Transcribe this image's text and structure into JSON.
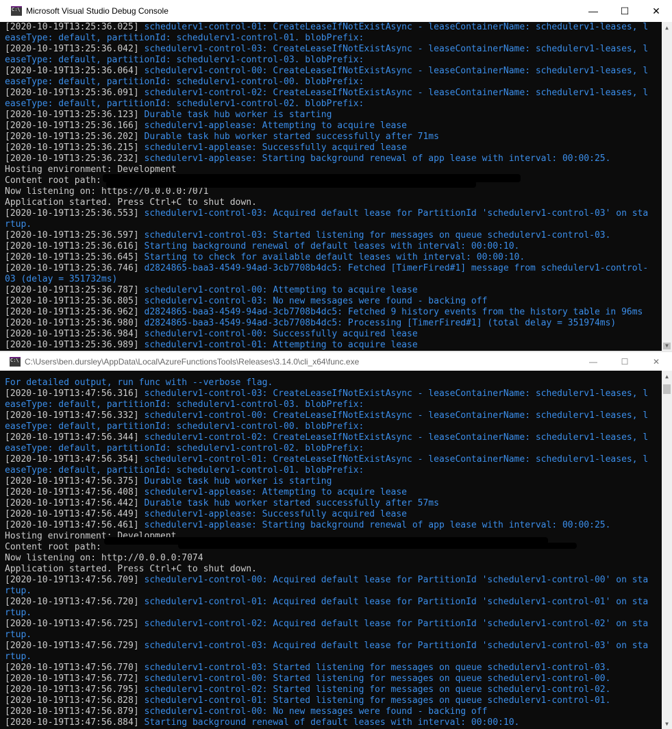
{
  "window1": {
    "title": "Microsoft Visual Studio Debug Console",
    "caption": {
      "minimize": "—",
      "maximize": "☐",
      "close": "✕"
    },
    "lines": [
      {
        "ts": "[2020-10-19T13:25:36.025]",
        "msg": " schedulerv1-control-01: CreateLeaseIfNotExistAsync - leaseContainerName: schedulerv1-leases, l"
      },
      {
        "ts": "",
        "msg": "easeType: default, partitionId: schedulerv1-control-01. blobPrefix:"
      },
      {
        "ts": "[2020-10-19T13:25:36.042]",
        "msg": " schedulerv1-control-03: CreateLeaseIfNotExistAsync - leaseContainerName: schedulerv1-leases, l"
      },
      {
        "ts": "",
        "msg": "easeType: default, partitionId: schedulerv1-control-03. blobPrefix:"
      },
      {
        "ts": "[2020-10-19T13:25:36.064]",
        "msg": " schedulerv1-control-00: CreateLeaseIfNotExistAsync - leaseContainerName: schedulerv1-leases, l"
      },
      {
        "ts": "",
        "msg": "easeType: default, partitionId: schedulerv1-control-00. blobPrefix:"
      },
      {
        "ts": "[2020-10-19T13:25:36.091]",
        "msg": " schedulerv1-control-02: CreateLeaseIfNotExistAsync - leaseContainerName: schedulerv1-leases, l"
      },
      {
        "ts": "",
        "msg": "easeType: default, partitionId: schedulerv1-control-02. blobPrefix:"
      },
      {
        "ts": "[2020-10-19T13:25:36.123]",
        "msg": " Durable task hub worker is starting"
      },
      {
        "ts": "[2020-10-19T13:25:36.166]",
        "msg": " schedulerv1-applease: Attempting to acquire lease"
      },
      {
        "ts": "[2020-10-19T13:25:36.202]",
        "msg": " Durable task hub worker started successfully after 71ms"
      },
      {
        "ts": "[2020-10-19T13:25:36.215]",
        "msg": " schedulerv1-applease: Successfully acquired lease"
      },
      {
        "ts": "[2020-10-19T13:25:36.232]",
        "msg": " schedulerv1-applease: Starting background renewal of app lease with interval: 00:00:25."
      },
      {
        "ts": "Hosting environment: Development",
        "msg": ""
      },
      {
        "ts": "Content root path:",
        "msg": ""
      },
      {
        "ts": "Now listening on: https://0.0.0.0:7071",
        "msg": ""
      },
      {
        "ts": "Application started. Press Ctrl+C to shut down.",
        "msg": ""
      },
      {
        "ts": "[2020-10-19T13:25:36.553]",
        "msg": " schedulerv1-control-03: Acquired default lease for PartitionId 'schedulerv1-control-03' on sta"
      },
      {
        "ts": "",
        "msg": "rtup."
      },
      {
        "ts": "[2020-10-19T13:25:36.597]",
        "msg": " schedulerv1-control-03: Started listening for messages on queue schedulerv1-control-03."
      },
      {
        "ts": "[2020-10-19T13:25:36.616]",
        "msg": " Starting background renewal of default leases with interval: 00:00:10."
      },
      {
        "ts": "[2020-10-19T13:25:36.645]",
        "msg": " Starting to check for available default leases with interval: 00:00:10."
      },
      {
        "ts": "[2020-10-19T13:25:36.746]",
        "msg": " d2824865-baa3-4549-94ad-3cb7708b4dc5: Fetched [TimerFired#1] message from schedulerv1-control-"
      },
      {
        "ts": "",
        "msg": "03 (delay = 351732ms)"
      },
      {
        "ts": "[2020-10-19T13:25:36.787]",
        "msg": " schedulerv1-control-00: Attempting to acquire lease"
      },
      {
        "ts": "[2020-10-19T13:25:36.805]",
        "msg": " schedulerv1-control-03: No new messages were found - backing off"
      },
      {
        "ts": "[2020-10-19T13:25:36.962]",
        "msg": " d2824865-baa3-4549-94ad-3cb7708b4dc5: Fetched 9 history events from the history table in 96ms"
      },
      {
        "ts": "[2020-10-19T13:25:36.980]",
        "msg": " d2824865-baa3-4549-94ad-3cb7708b4dc5: Processing [TimerFired#1] (total delay = 351974ms)"
      },
      {
        "ts": "[2020-10-19T13:25:36.984]",
        "msg": " schedulerv1-control-00: Successfully acquired lease"
      },
      {
        "ts": "[2020-10-19T13:25:36.989]",
        "msg": " schedulerv1-control-01: Attempting to acquire lease"
      }
    ]
  },
  "window2": {
    "title": "C:\\Users\\ben.dursley\\AppData\\Local\\AzureFunctionsTools\\Releases\\3.14.0\\cli_x64\\func.exe",
    "caption": {
      "minimize": "—",
      "maximize": "☐",
      "close": "✕"
    },
    "lines": [
      {
        "ts": "",
        "msg": "For detailed output, run func with --verbose flag."
      },
      {
        "ts": "[2020-10-19T13:47:56.316]",
        "msg": " schedulerv1-control-03: CreateLeaseIfNotExistAsync - leaseContainerName: schedulerv1-leases, l"
      },
      {
        "ts": "",
        "msg": "easeType: default, partitionId: schedulerv1-control-03. blobPrefix:"
      },
      {
        "ts": "[2020-10-19T13:47:56.332]",
        "msg": " schedulerv1-control-00: CreateLeaseIfNotExistAsync - leaseContainerName: schedulerv1-leases, l"
      },
      {
        "ts": "",
        "msg": "easeType: default, partitionId: schedulerv1-control-00. blobPrefix:"
      },
      {
        "ts": "[2020-10-19T13:47:56.344]",
        "msg": " schedulerv1-control-02: CreateLeaseIfNotExistAsync - leaseContainerName: schedulerv1-leases, l"
      },
      {
        "ts": "",
        "msg": "easeType: default, partitionId: schedulerv1-control-02. blobPrefix:"
      },
      {
        "ts": "[2020-10-19T13:47:56.354]",
        "msg": " schedulerv1-control-01: CreateLeaseIfNotExistAsync - leaseContainerName: schedulerv1-leases, l"
      },
      {
        "ts": "",
        "msg": "easeType: default, partitionId: schedulerv1-control-01. blobPrefix:"
      },
      {
        "ts": "[2020-10-19T13:47:56.375]",
        "msg": " Durable task hub worker is starting"
      },
      {
        "ts": "[2020-10-19T13:47:56.408]",
        "msg": " schedulerv1-applease: Attempting to acquire lease"
      },
      {
        "ts": "[2020-10-19T13:47:56.442]",
        "msg": " Durable task hub worker started successfully after 57ms"
      },
      {
        "ts": "[2020-10-19T13:47:56.449]",
        "msg": " schedulerv1-applease: Successfully acquired lease"
      },
      {
        "ts": "[2020-10-19T13:47:56.461]",
        "msg": " schedulerv1-applease: Starting background renewal of app lease with interval: 00:00:25."
      },
      {
        "ts": "Hosting environment: Development",
        "msg": ""
      },
      {
        "ts": "Content root path:",
        "msg": ""
      },
      {
        "ts": "Now listening on: http://0.0.0.0:7074",
        "msg": ""
      },
      {
        "ts": "Application started. Press Ctrl+C to shut down.",
        "msg": ""
      },
      {
        "ts": "[2020-10-19T13:47:56.709]",
        "msg": " schedulerv1-control-00: Acquired default lease for PartitionId 'schedulerv1-control-00' on sta"
      },
      {
        "ts": "",
        "msg": "rtup."
      },
      {
        "ts": "[2020-10-19T13:47:56.720]",
        "msg": " schedulerv1-control-01: Acquired default lease for PartitionId 'schedulerv1-control-01' on sta"
      },
      {
        "ts": "",
        "msg": "rtup."
      },
      {
        "ts": "[2020-10-19T13:47:56.725]",
        "msg": " schedulerv1-control-02: Acquired default lease for PartitionId 'schedulerv1-control-02' on sta"
      },
      {
        "ts": "",
        "msg": "rtup."
      },
      {
        "ts": "[2020-10-19T13:47:56.729]",
        "msg": " schedulerv1-control-03: Acquired default lease for PartitionId 'schedulerv1-control-03' on sta"
      },
      {
        "ts": "",
        "msg": "rtup."
      },
      {
        "ts": "[2020-10-19T13:47:56.770]",
        "msg": " schedulerv1-control-03: Started listening for messages on queue schedulerv1-control-03."
      },
      {
        "ts": "[2020-10-19T13:47:56.772]",
        "msg": " schedulerv1-control-00: Started listening for messages on queue schedulerv1-control-00."
      },
      {
        "ts": "[2020-10-19T13:47:56.795]",
        "msg": " schedulerv1-control-02: Started listening for messages on queue schedulerv1-control-02."
      },
      {
        "ts": "[2020-10-19T13:47:56.828]",
        "msg": " schedulerv1-control-01: Started listening for messages on queue schedulerv1-control-01."
      },
      {
        "ts": "[2020-10-19T13:47:56.879]",
        "msg": " schedulerv1-control-00: No new messages were found - backing off"
      },
      {
        "ts": "[2020-10-19T13:47:56.884]",
        "msg": " Starting background renewal of default leases with interval: 00:00:10."
      }
    ]
  },
  "colors": {
    "console_bg": "#0c0c0c",
    "text_gray": "#cccccc",
    "text_blue": "#3b8eea"
  }
}
